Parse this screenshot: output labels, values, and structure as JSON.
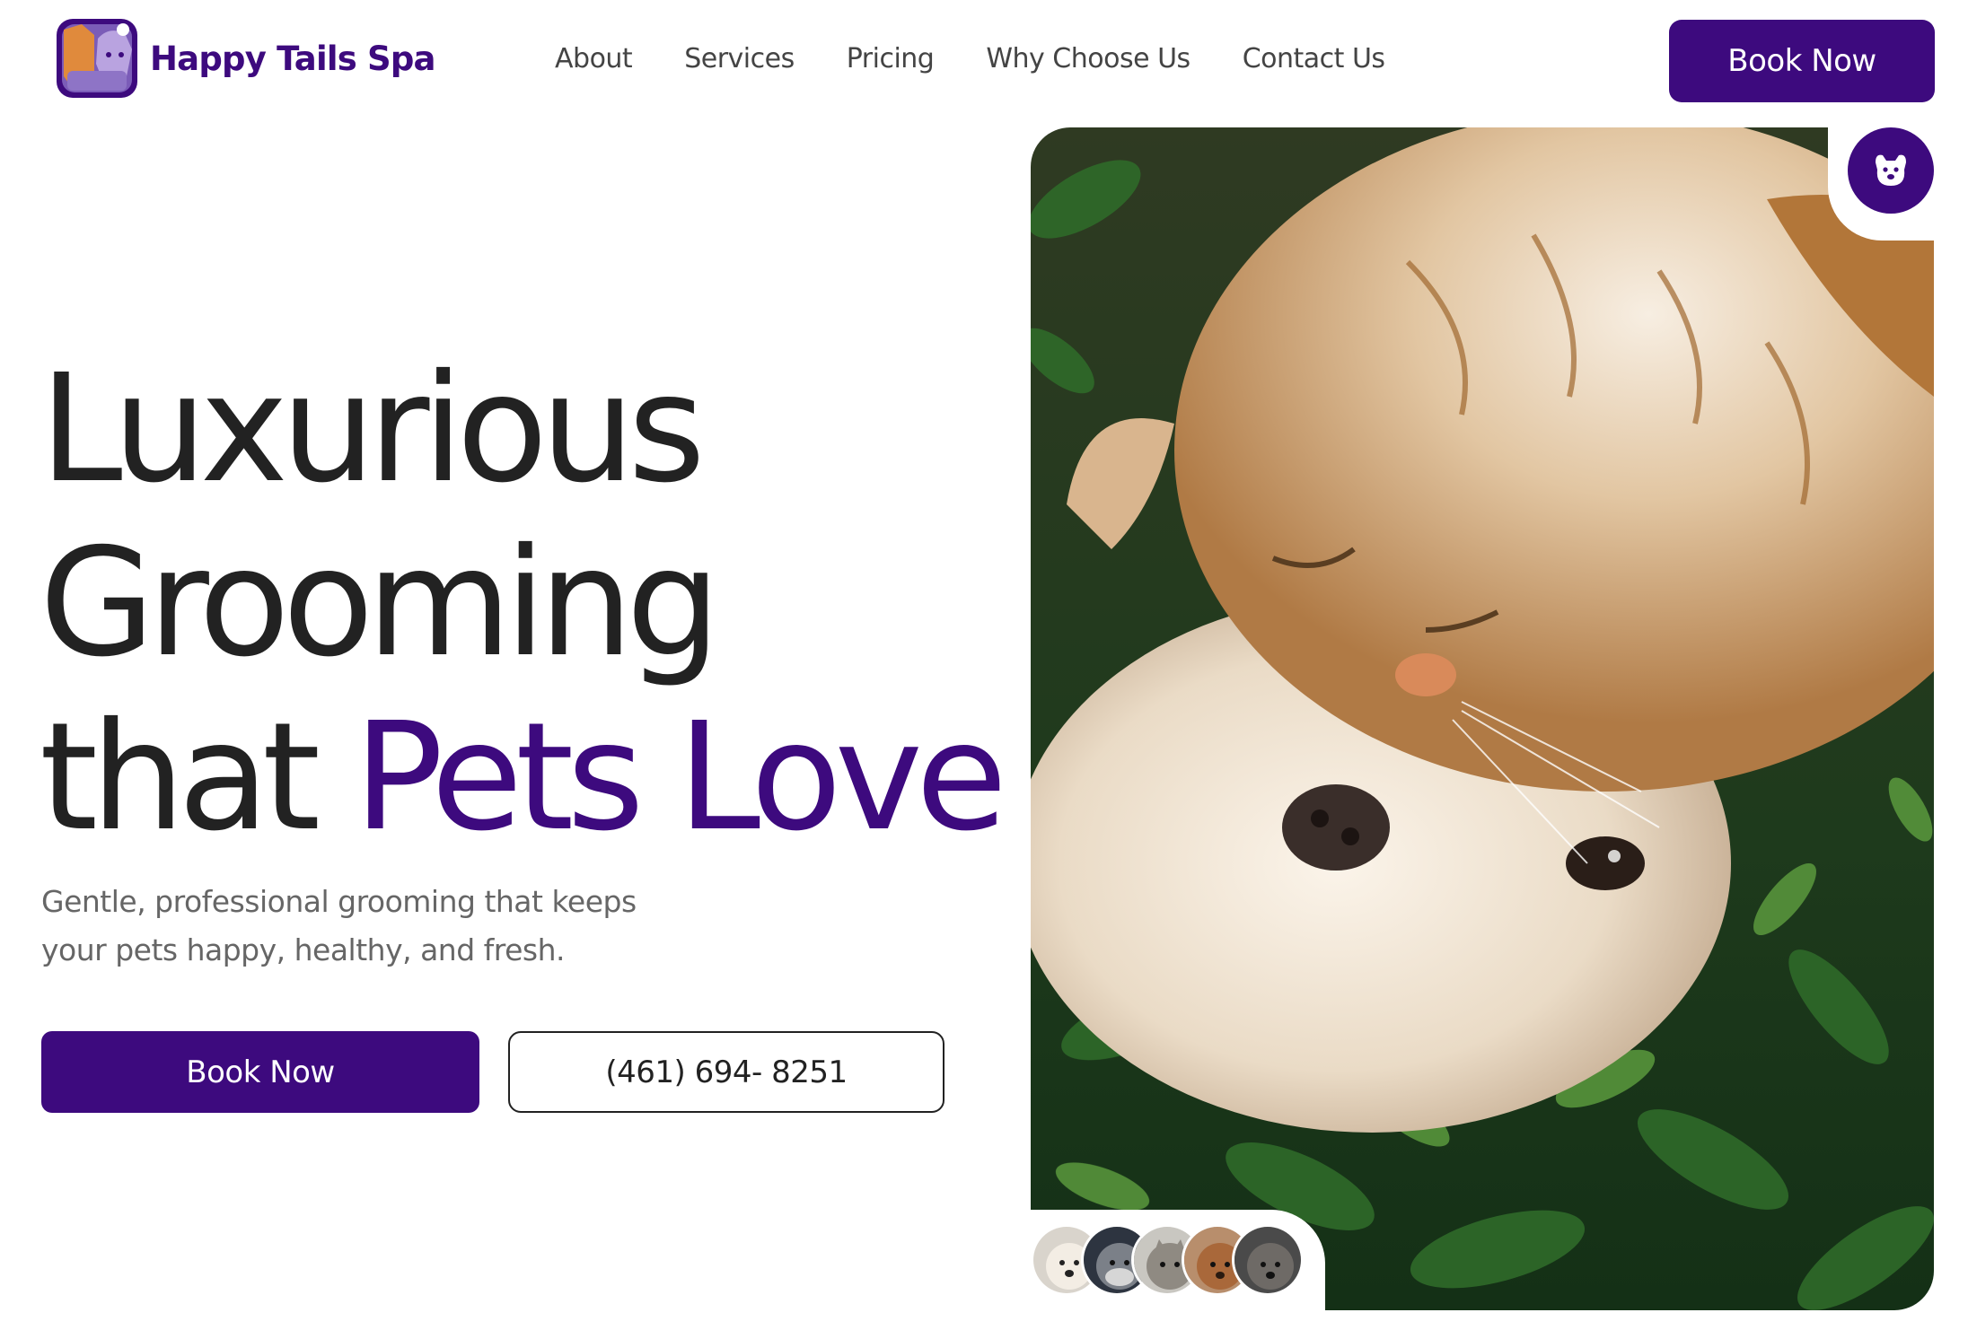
{
  "brand": {
    "name": "Happy Tails Spa",
    "logo_icon": "cat-and-dog-logo-icon",
    "accent_color": "#3d0a7e"
  },
  "nav": {
    "items": [
      {
        "label": "About"
      },
      {
        "label": "Services"
      },
      {
        "label": "Pricing"
      },
      {
        "label": "Why Choose Us"
      },
      {
        "label": "Contact Us"
      }
    ],
    "cta_label": "Book Now"
  },
  "hero": {
    "headline_line1": "Luxurious",
    "headline_line2": "Grooming",
    "headline_line3_plain": "that",
    "headline_line3_accent": "Pets Love",
    "subtitle": "Gentle, professional grooming that keeps your pets happy, healthy, and fresh.",
    "primary_cta": "Book Now",
    "phone": "(461) 694- 8251",
    "image_icon": "dog-face-icon",
    "avatar_count": 5
  }
}
